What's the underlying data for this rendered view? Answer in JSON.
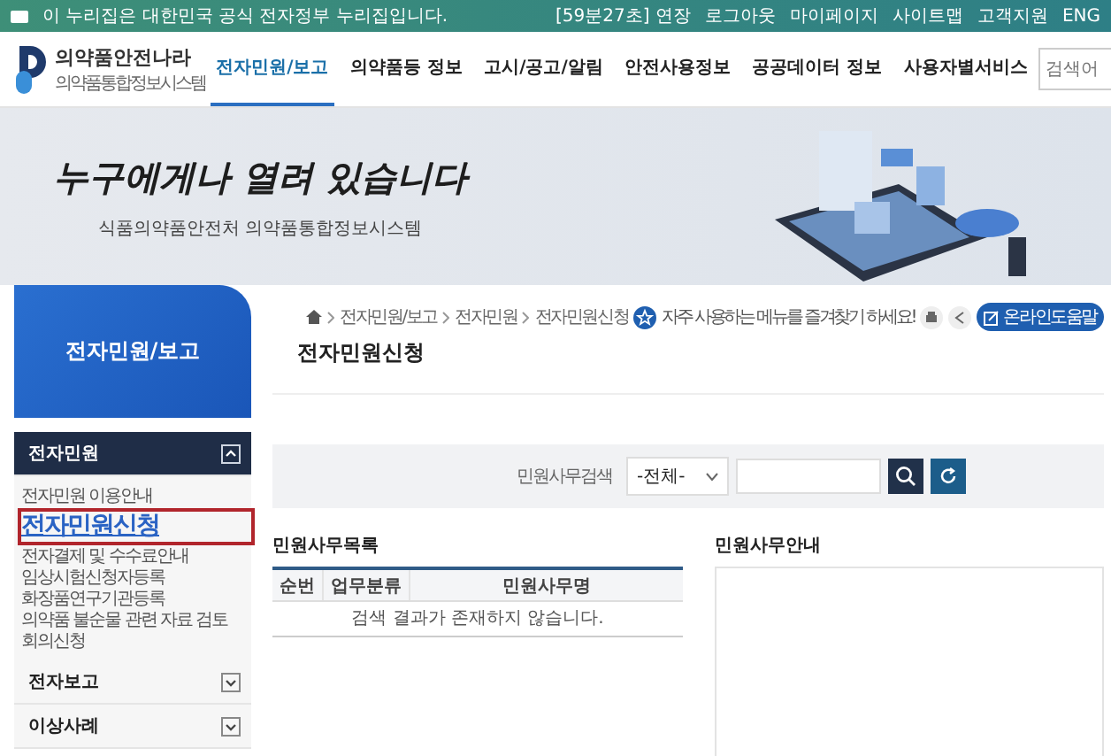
{
  "gov_bar": {
    "notice": "이 누리집은 대한민국 공식 전자정부 누리집입니다.",
    "session": "[59분27초] 연장",
    "links": [
      "로그아웃",
      "마이페이지",
      "사이트맵",
      "고객지원",
      "ENG"
    ]
  },
  "header": {
    "logo": {
      "title": "의약품안전나라",
      "subtitle": "의약품통합정보시스템"
    },
    "nav": [
      {
        "label": "전자민원/보고",
        "selected": true
      },
      {
        "label": "의약품등 정보",
        "selected": false
      },
      {
        "label": "고시/공고/알림",
        "selected": false
      },
      {
        "label": "안전사용정보",
        "selected": false
      },
      {
        "label": "공공데이터 정보",
        "selected": false
      },
      {
        "label": "사용자별서비스",
        "selected": false
      }
    ],
    "search": {
      "placeholder": "검색어"
    }
  },
  "banner": {
    "slogan": "누구에게나 열려 있습니다",
    "subtitle": "식품의약품안전처 의약품통합정보시스템"
  },
  "sidebar": {
    "title": "전자민원/보고",
    "groups": [
      {
        "label": "전자민원",
        "expanded": true,
        "children": [
          {
            "label": "전자민원 이용안내",
            "selected": false
          },
          {
            "label": "전자민원신청",
            "selected": true
          },
          {
            "label": "전자결제 및 수수료안내",
            "selected": false
          },
          {
            "label": "임상시험신청자등록",
            "selected": false
          },
          {
            "label": "화장품연구기관등록",
            "selected": false
          },
          {
            "label": "의약품 불순물 관련 자료 검토",
            "selected": false
          },
          {
            "label": "회의신청",
            "selected": false
          }
        ]
      },
      {
        "label": "전자보고",
        "expanded": false
      },
      {
        "label": "이상사례",
        "expanded": false
      }
    ]
  },
  "breadcrumb": [
    "전자민원/보고",
    "전자민원",
    "전자민원신청"
  ],
  "favorite_hint": "자주 사용하는 메뉴를 즐겨찾기 하세요!",
  "help_button": "온라인도움말",
  "page_title": "전자민원신청",
  "search_panel": {
    "label": "민원사무검색",
    "select_value": "-전체-"
  },
  "list": {
    "title": "민원사무목록",
    "columns": [
      "순번",
      "업무분류",
      "민원사무명"
    ],
    "empty_message": "검색 결과가 존재하지 않습니다."
  },
  "info": {
    "title": "민원사무안내"
  }
}
